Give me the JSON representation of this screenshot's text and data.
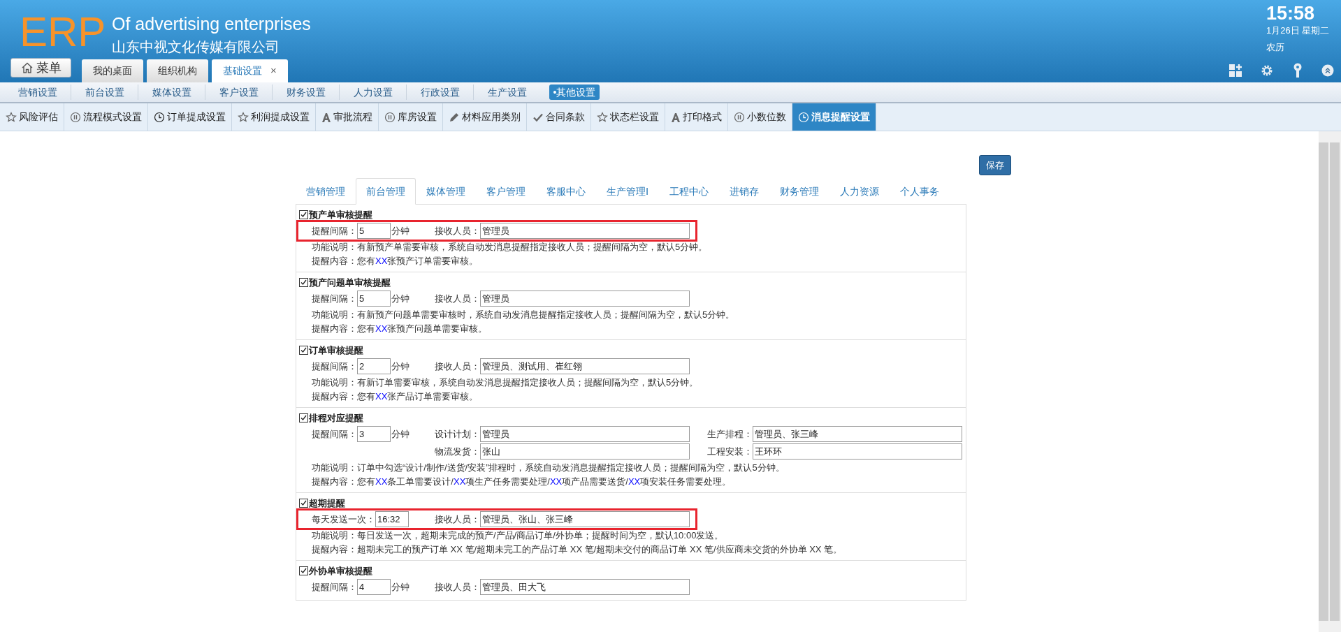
{
  "header": {
    "logo": "ERP",
    "title": "Of advertising enterprises",
    "company": "山东中视文化传媒有限公司",
    "menu_button": "菜单",
    "time": "15:58",
    "date": "1月26日 星期二",
    "lunar": "农历"
  },
  "tabs": [
    {
      "label": "我的桌面",
      "selected": false
    },
    {
      "label": "组织机构",
      "selected": false
    },
    {
      "label": "基础设置",
      "selected": true,
      "close": "×"
    }
  ],
  "nav": [
    {
      "label": "营销设置",
      "selected": false
    },
    {
      "label": "前台设置",
      "selected": false
    },
    {
      "label": "媒体设置",
      "selected": false
    },
    {
      "label": "客户设置",
      "selected": false
    },
    {
      "label": "财务设置",
      "selected": false
    },
    {
      "label": "人力设置",
      "selected": false
    },
    {
      "label": "行政设置",
      "selected": false
    },
    {
      "label": "生产设置",
      "selected": false
    },
    {
      "label": "•其他设置",
      "selected": true
    }
  ],
  "toolbar": [
    {
      "label": "风险评估",
      "kind": "star",
      "selected": false
    },
    {
      "label": "流程模式设置",
      "kind": "pause",
      "selected": false
    },
    {
      "label": "订单提成设置",
      "kind": "clock",
      "selected": false
    },
    {
      "label": "利润提成设置",
      "kind": "star",
      "selected": false
    },
    {
      "label": "审批流程",
      "kind": "letter",
      "selected": false
    },
    {
      "label": "库房设置",
      "kind": "pause",
      "selected": false
    },
    {
      "label": "材料应用类别",
      "kind": "pencil",
      "selected": false
    },
    {
      "label": "合同条款",
      "kind": "check",
      "selected": false
    },
    {
      "label": "状态栏设置",
      "kind": "star",
      "selected": false
    },
    {
      "label": "打印格式",
      "kind": "letter",
      "selected": false
    },
    {
      "label": "小数位数",
      "kind": "pause",
      "selected": false
    },
    {
      "label": "消息提醒设置",
      "kind": "clock",
      "selected": true
    }
  ],
  "save_button": "保存",
  "module_tabs": [
    {
      "label": "营销管理",
      "selected": false
    },
    {
      "label": "前台管理",
      "selected": true
    },
    {
      "label": "媒体管理",
      "selected": false
    },
    {
      "label": "客户管理",
      "selected": false
    },
    {
      "label": "客服中心",
      "selected": false
    },
    {
      "label": "生产管理Ⅰ",
      "selected": false
    },
    {
      "label": "工程中心",
      "selected": false
    },
    {
      "label": "进销存",
      "selected": false
    },
    {
      "label": "财务管理",
      "selected": false
    },
    {
      "label": "人力资源",
      "selected": false
    },
    {
      "label": "个人事务",
      "selected": false
    }
  ],
  "sections": [
    {
      "title": "预产单审核提醒",
      "checked": true,
      "highlighted": true,
      "rows": [
        [
          {
            "kind": "short",
            "label": "提醒间隔：",
            "value": "5",
            "unit": "分钟"
          },
          {
            "kind": "long",
            "label": "接收人员：",
            "value": "管理员"
          }
        ]
      ],
      "description": "功能说明：有新预产单需要审核，系统自动发消息提醒指定接收人员；提醒间隔为空，默认5分钟。",
      "content": [
        {
          "text": "提醒内容：您有",
          "highlight": false
        },
        {
          "text": "XX",
          "highlight": true
        },
        {
          "text": "张预产订单需要审核。",
          "highlight": false
        }
      ]
    },
    {
      "title": "预产问题单审核提醒",
      "checked": true,
      "highlighted": false,
      "rows": [
        [
          {
            "kind": "short",
            "label": "提醒间隔：",
            "value": "5",
            "unit": "分钟"
          },
          {
            "kind": "long",
            "label": "接收人员：",
            "value": "管理员"
          }
        ]
      ],
      "description": "功能说明：有新预产问题单需要审核时，系统自动发消息提醒指定接收人员；提醒间隔为空，默认5分钟。",
      "content": [
        {
          "text": "提醒内容：您有",
          "highlight": false
        },
        {
          "text": "XX",
          "highlight": true
        },
        {
          "text": "张预产问题单需要审核。",
          "highlight": false
        }
      ]
    },
    {
      "title": "订单审核提醒",
      "checked": true,
      "highlighted": false,
      "rows": [
        [
          {
            "kind": "short",
            "label": "提醒间隔：",
            "value": "2",
            "unit": "分钟"
          },
          {
            "kind": "long",
            "label": "接收人员：",
            "value": "管理员、测试用、崔红翎"
          }
        ]
      ],
      "description": "功能说明：有新订单需要审核，系统自动发消息提醒指定接收人员；提醒间隔为空，默认5分钟。",
      "content": [
        {
          "text": "提醒内容：您有",
          "highlight": false
        },
        {
          "text": "XX",
          "highlight": true
        },
        {
          "text": "张产品订单需要审核。",
          "highlight": false
        }
      ]
    },
    {
      "title": "排程对应提醒",
      "checked": true,
      "highlighted": false,
      "rows": [
        [
          {
            "kind": "short",
            "label": "提醒间隔：",
            "value": "3",
            "unit": "分钟"
          },
          {
            "kind": "long",
            "label": "设计计划：",
            "value": "管理员"
          },
          {
            "kind": "long",
            "label": "生产排程：",
            "value": "管理员、张三峰"
          }
        ],
        [
          "",
          {
            "kind": "long",
            "label": "物流发货：",
            "value": "张山"
          },
          {
            "kind": "long",
            "label": "工程安装：",
            "value": "王环环"
          }
        ]
      ],
      "description": "功能说明：订单中勾选“设计/制作/送货/安装”排程时，系统自动发消息提醒指定接收人员；提醒间隔为空，默认5分钟。",
      "content": [
        {
          "text": "提醒内容：您有",
          "highlight": false
        },
        {
          "text": "XX",
          "highlight": true
        },
        {
          "text": "条工单需要设计/",
          "highlight": false
        },
        {
          "text": "XX",
          "highlight": true
        },
        {
          "text": "项生产任务需要处理/",
          "highlight": false
        },
        {
          "text": "XX",
          "highlight": true
        },
        {
          "text": "项产品需要送货/",
          "highlight": false
        },
        {
          "text": "XX",
          "highlight": true
        },
        {
          "text": "项安装任务需要处理。",
          "highlight": false
        }
      ]
    },
    {
      "title": "超期提醒",
      "checked": true,
      "highlighted": true,
      "rows": [
        [
          {
            "kind": "time",
            "label": "每天发送一次：",
            "value": "16:32"
          },
          {
            "kind": "long",
            "label": "接收人员：",
            "value": "管理员、张山、张三峰"
          }
        ]
      ],
      "description": "功能说明：每日发送一次，超期未完成的预产/产品/商品订单/外协单；提醒时间为空，默认10:00发送。",
      "content": [
        {
          "text": "提醒内容：超期未完工的预产订单 XX 笔/超期未完工的产品订单 XX 笔/超期未交付的商品订单 XX 笔/供应商未交货的外协单 XX 笔。",
          "highlight": false
        }
      ]
    },
    {
      "title": "外协单审核提醒",
      "checked": true,
      "highlighted": false,
      "rows": [
        [
          {
            "kind": "short",
            "label": "提醒间隔：",
            "value": "4",
            "unit": "分钟"
          },
          {
            "kind": "long",
            "label": "接收人员：",
            "value": "管理员、田大飞"
          }
        ]
      ]
    }
  ]
}
